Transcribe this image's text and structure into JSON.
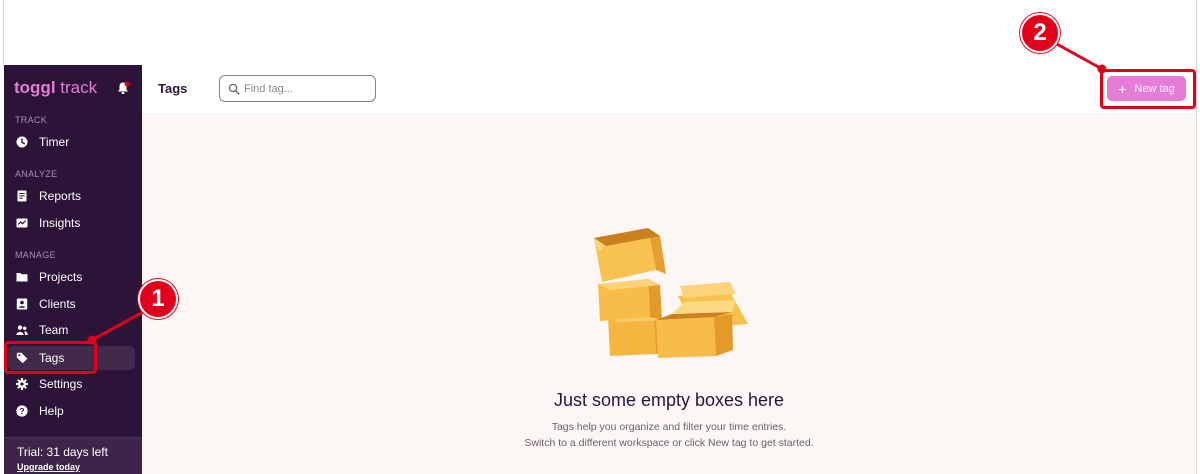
{
  "sidebar": {
    "logo_part1": "toggl",
    "logo_part2": "track",
    "sections": [
      {
        "label": "TRACK"
      },
      {
        "label": "ANALYZE"
      },
      {
        "label": "MANAGE"
      }
    ],
    "items": [
      {
        "label": "Timer",
        "icon": "clock-icon"
      },
      {
        "label": "Reports",
        "icon": "document-icon"
      },
      {
        "label": "Insights",
        "icon": "chart-icon"
      },
      {
        "label": "Projects",
        "icon": "folder-icon"
      },
      {
        "label": "Clients",
        "icon": "client-icon"
      },
      {
        "label": "Team",
        "icon": "team-icon"
      },
      {
        "label": "Tags",
        "icon": "tag-icon",
        "active": true
      },
      {
        "label": "Settings",
        "icon": "gear-icon"
      },
      {
        "label": "Help",
        "icon": "help-icon"
      }
    ],
    "trial_text": "Trial: 31 days left",
    "upgrade_label": "Upgrade today"
  },
  "header": {
    "title": "Tags",
    "search_placeholder": "Find tag...",
    "new_tag_label": "New tag"
  },
  "empty_state": {
    "title": "Just some empty boxes here",
    "line1": "Tags help you organize and filter your time entries.",
    "line2": "Switch to a different workspace or click New tag to get started."
  },
  "annotations": {
    "step1": "1",
    "step2": "2"
  },
  "colors": {
    "sidebar_bg": "#2c1338",
    "accent": "#e57cd8",
    "callout_red": "#e0001b",
    "content_bg": "#fcf6f5"
  }
}
